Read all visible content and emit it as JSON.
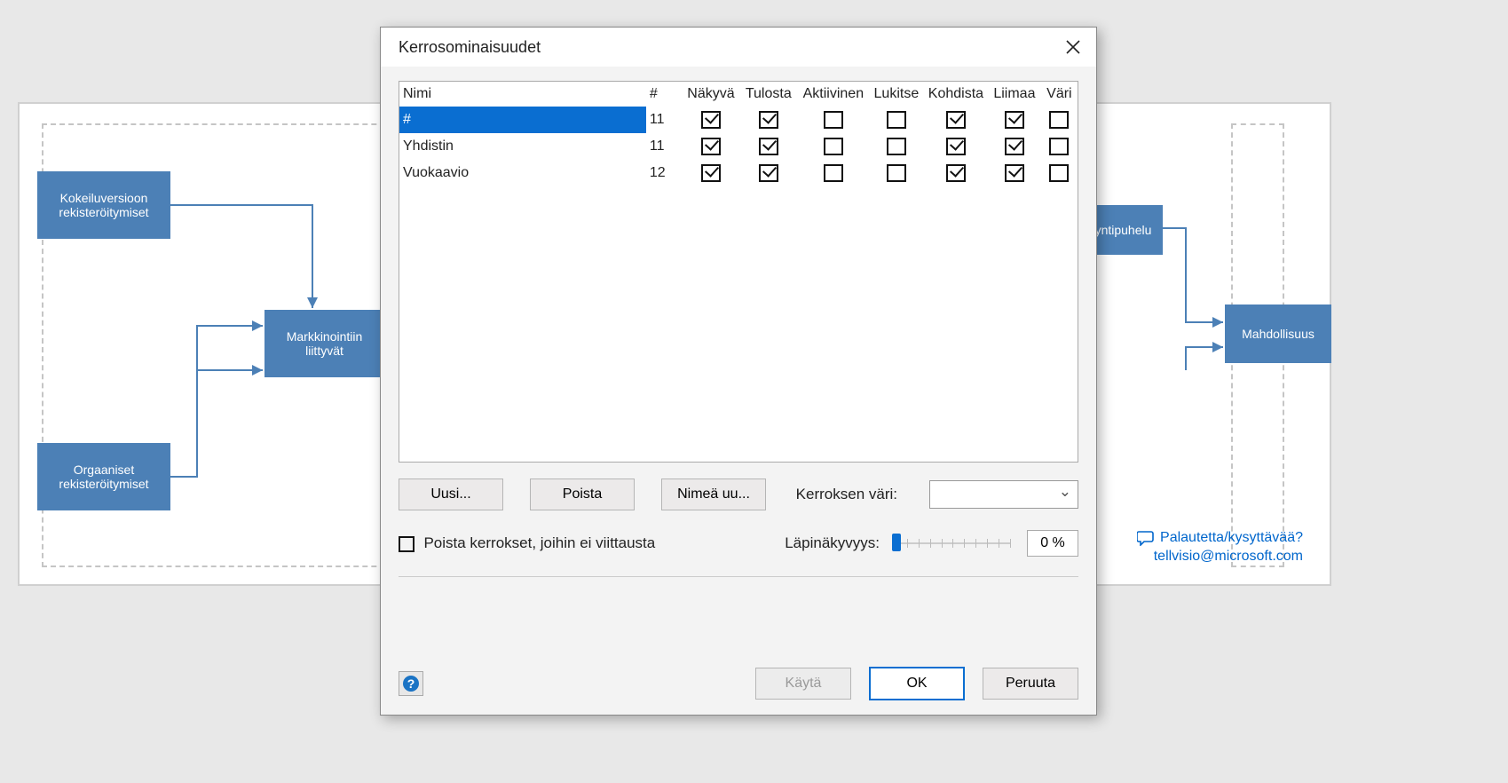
{
  "dialog": {
    "title": "Kerrosominaisuudet",
    "columns": {
      "name": "Nimi",
      "count": "#",
      "visible": "Näkyvä",
      "print": "Tulosta",
      "active": "Aktiivinen",
      "lock": "Lukitse",
      "snap": "Kohdista",
      "glue": "Liimaa",
      "color": "Väri"
    },
    "rows": [
      {
        "name": "#",
        "count": "11",
        "visible": true,
        "print": true,
        "active": false,
        "lock": false,
        "snap": true,
        "glue": true,
        "color": false,
        "selected": true
      },
      {
        "name": "Yhdistin",
        "count": "11",
        "visible": true,
        "print": true,
        "active": false,
        "lock": false,
        "snap": true,
        "glue": true,
        "color": false,
        "selected": false
      },
      {
        "name": "Vuokaavio",
        "count": "12",
        "visible": true,
        "print": true,
        "active": false,
        "lock": false,
        "snap": true,
        "glue": true,
        "color": false,
        "selected": false
      }
    ],
    "buttons": {
      "new": "Uusi...",
      "delete": "Poista",
      "rename": "Nimeä uu..."
    },
    "color_label": "Kerroksen väri:",
    "remove_unref": "Poista kerrokset, joihin ei viittausta",
    "transparency_label": "Läpinäkyvyys:",
    "transparency_value": "0 %",
    "apply": "Käytä",
    "ok": "OK",
    "cancel": "Peruuta"
  },
  "background": {
    "box1": "Kokeiluversioon rekisteröitymiset",
    "box2": "Orgaaniset rekisteröitymiset",
    "box3": "Markkinointiin liittyvät",
    "box4": "yyntipuhelu",
    "box5": "Mahdollisuus",
    "feedback_line1": "Palautetta/kysyttävää?",
    "feedback_line2": "tellvisio@microsoft.com"
  }
}
